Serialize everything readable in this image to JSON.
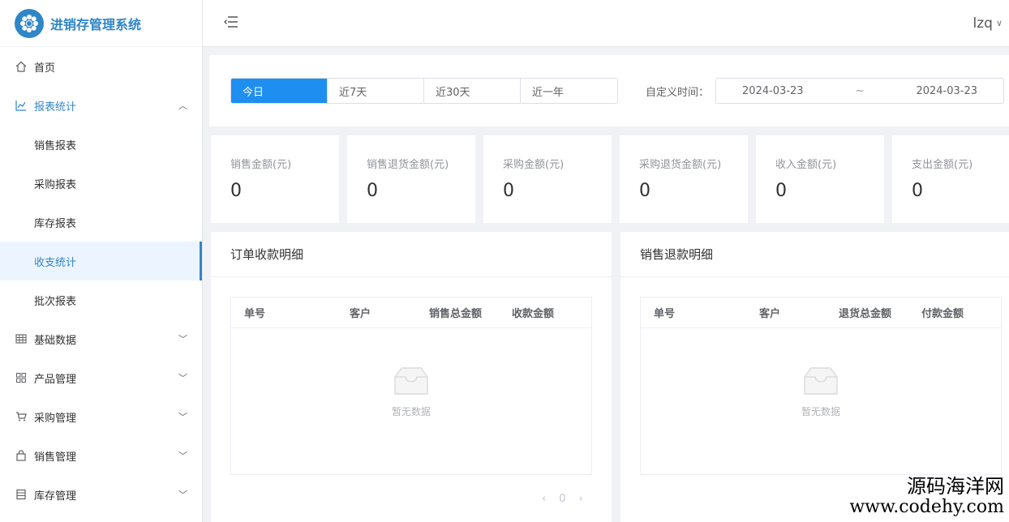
{
  "app": {
    "title": "进销存管理系统"
  },
  "header": {
    "user": "lzq"
  },
  "sidebar": {
    "items": [
      {
        "label": "首页",
        "icon": "home-icon",
        "arrow": ""
      },
      {
        "label": "报表统计",
        "icon": "chart-icon",
        "arrow": "up"
      },
      {
        "label": "销售报表",
        "sub": true
      },
      {
        "label": "采购报表",
        "sub": true
      },
      {
        "label": "库存报表",
        "sub": true
      },
      {
        "label": "收支统计",
        "sub": true,
        "active": true
      },
      {
        "label": "批次报表",
        "sub": true
      },
      {
        "label": "基础数据",
        "icon": "table-icon",
        "arrow": "down"
      },
      {
        "label": "产品管理",
        "icon": "grid-icon",
        "arrow": "down"
      },
      {
        "label": "采购管理",
        "icon": "cart-icon",
        "arrow": "down"
      },
      {
        "label": "销售管理",
        "icon": "bag-icon",
        "arrow": "down"
      },
      {
        "label": "库存管理",
        "icon": "archive-icon",
        "arrow": "down"
      }
    ]
  },
  "filter": {
    "ranges": [
      "今日",
      "近7天",
      "近30天",
      "近一年"
    ],
    "active_range": "今日",
    "custom_label": "自定义时间：",
    "date_start": "2024-03-23",
    "date_sep": "~",
    "date_end": "2024-03-23"
  },
  "stats": [
    {
      "label": "销售金额(元)",
      "value": "0"
    },
    {
      "label": "销售退货金额(元)",
      "value": "0"
    },
    {
      "label": "采购金额(元)",
      "value": "0"
    },
    {
      "label": "采购退货金额(元)",
      "value": "0"
    },
    {
      "label": "收入金额(元)",
      "value": "0"
    },
    {
      "label": "支出金额(元)",
      "value": "0"
    }
  ],
  "panels": {
    "left": {
      "title": "订单收款明细",
      "columns": [
        "单号",
        "客户",
        "销售总金额",
        "收款金额"
      ],
      "empty_text": "暂无数据",
      "page": "0"
    },
    "right": {
      "title": "销售退款明细",
      "columns": [
        "单号",
        "客户",
        "退货总金额",
        "付款金额"
      ],
      "empty_text": "暂无数据"
    }
  },
  "watermark": {
    "line1": "源码海洋网",
    "line2": "www.codehy.com"
  },
  "colors": {
    "primary": "#1f8ef1",
    "brand": "#2f86c8"
  }
}
